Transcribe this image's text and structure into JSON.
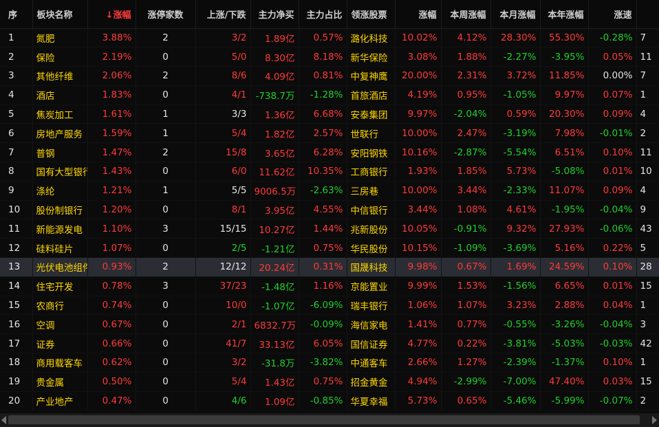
{
  "headers": {
    "seq": "序",
    "name": "板块名称",
    "sort_arrow": "↓",
    "change": "涨幅",
    "limit_up": "涨停家数",
    "updown": "上涨/下跌",
    "net_inflow": "主力净买",
    "ratio": "主力占比",
    "leader": "领涨股票",
    "leader_change": "涨幅",
    "week": "本周涨幅",
    "month": "本月涨幅",
    "year": "本年涨幅",
    "speed": "涨速",
    "extra": ""
  },
  "colors": {
    "up": "#ff3a3a",
    "down": "#1fd12b",
    "name": "#ffd700",
    "selected_row": "#2a2d33"
  },
  "selected_index": 13,
  "rows": [
    {
      "seq": "1",
      "name": "氮肥",
      "change": "3.88%",
      "limit": "2",
      "ud": "3/2",
      "net": "1.89亿",
      "ratio": "0.57%",
      "stock": "潞化科技",
      "schg": "10.02%",
      "week": "4.12%",
      "month": "28.30%",
      "year": "55.30%",
      "speed": "-0.28%",
      "extra": "7"
    },
    {
      "seq": "2",
      "name": "保险",
      "change": "2.19%",
      "limit": "0",
      "ud": "5/0",
      "net": "8.30亿",
      "ratio": "8.18%",
      "stock": "新华保险",
      "schg": "3.08%",
      "week": "1.88%",
      "month": "-2.27%",
      "year": "-3.95%",
      "speed": "0.05%",
      "extra": "11"
    },
    {
      "seq": "3",
      "name": "其他纤维",
      "change": "2.06%",
      "limit": "2",
      "ud": "8/6",
      "net": "4.09亿",
      "ratio": "0.81%",
      "stock": "中复神鹰",
      "schg": "20.00%",
      "week": "2.31%",
      "month": "3.72%",
      "year": "11.85%",
      "speed": "0.00%",
      "extra": "7"
    },
    {
      "seq": "4",
      "name": "酒店",
      "change": "1.83%",
      "limit": "0",
      "ud": "4/1",
      "net": "-738.7万",
      "ratio": "-1.28%",
      "stock": "首旅酒店",
      "schg": "4.19%",
      "week": "0.95%",
      "month": "-1.05%",
      "year": "9.97%",
      "speed": "0.07%",
      "extra": "1"
    },
    {
      "seq": "5",
      "name": "焦炭加工",
      "change": "1.61%",
      "limit": "1",
      "ud": "3/3",
      "net": "1.36亿",
      "ratio": "6.68%",
      "stock": "安泰集团",
      "schg": "9.97%",
      "week": "-2.04%",
      "month": "0.59%",
      "year": "20.30%",
      "speed": "0.09%",
      "extra": "4"
    },
    {
      "seq": "6",
      "name": "房地产服务",
      "change": "1.59%",
      "limit": "1",
      "ud": "5/4",
      "net": "1.82亿",
      "ratio": "2.57%",
      "stock": "世联行",
      "schg": "10.00%",
      "week": "2.47%",
      "month": "-3.19%",
      "year": "7.98%",
      "speed": "-0.01%",
      "extra": "2"
    },
    {
      "seq": "7",
      "name": "普钢",
      "change": "1.47%",
      "limit": "2",
      "ud": "15/8",
      "net": "3.65亿",
      "ratio": "6.28%",
      "stock": "安阳钢铁",
      "schg": "10.16%",
      "week": "-2.87%",
      "month": "-5.54%",
      "year": "6.51%",
      "speed": "0.10%",
      "extra": "11"
    },
    {
      "seq": "8",
      "name": "国有大型银行",
      "change": "1.43%",
      "limit": "0",
      "ud": "6/0",
      "net": "11.62亿",
      "ratio": "10.35%",
      "stock": "工商银行",
      "schg": "1.93%",
      "week": "1.85%",
      "month": "5.73%",
      "year": "-5.08%",
      "speed": "0.01%",
      "extra": "10"
    },
    {
      "seq": "9",
      "name": "涤纶",
      "change": "1.21%",
      "limit": "1",
      "ud": "5/5",
      "net": "9006.5万",
      "ratio": "-2.63%",
      "stock": "三房巷",
      "schg": "10.00%",
      "week": "3.44%",
      "month": "-2.33%",
      "year": "11.07%",
      "speed": "0.09%",
      "extra": "4"
    },
    {
      "seq": "10",
      "name": "股份制银行",
      "change": "1.20%",
      "limit": "0",
      "ud": "8/1",
      "net": "3.95亿",
      "ratio": "4.55%",
      "stock": "中信银行",
      "schg": "3.44%",
      "week": "1.08%",
      "month": "4.61%",
      "year": "-1.95%",
      "speed": "-0.04%",
      "extra": "9"
    },
    {
      "seq": "11",
      "name": "新能源发电",
      "change": "1.10%",
      "limit": "3",
      "ud": "15/15",
      "net": "10.27亿",
      "ratio": "1.44%",
      "stock": "兆新股份",
      "schg": "10.05%",
      "week": "-0.91%",
      "month": "9.32%",
      "year": "27.93%",
      "speed": "-0.06%",
      "extra": "43"
    },
    {
      "seq": "12",
      "name": "硅料硅片",
      "change": "1.07%",
      "limit": "0",
      "ud": "2/5",
      "net": "-1.21亿",
      "ratio": "0.75%",
      "stock": "华民股份",
      "schg": "10.15%",
      "week": "-1.09%",
      "month": "-3.69%",
      "year": "5.16%",
      "speed": "0.22%",
      "extra": "5"
    },
    {
      "seq": "13",
      "name": "光伏电池组件",
      "change": "0.93%",
      "limit": "2",
      "ud": "12/12",
      "net": "20.24亿",
      "ratio": "0.31%",
      "stock": "国晟科技",
      "schg": "9.98%",
      "week": "0.67%",
      "month": "1.69%",
      "year": "24.59%",
      "speed": "0.10%",
      "extra": "28"
    },
    {
      "seq": "14",
      "name": "住宅开发",
      "change": "0.78%",
      "limit": "3",
      "ud": "37/23",
      "net": "-1.48亿",
      "ratio": "1.16%",
      "stock": "京能置业",
      "schg": "9.99%",
      "week": "1.53%",
      "month": "-1.56%",
      "year": "6.65%",
      "speed": "0.01%",
      "extra": "15"
    },
    {
      "seq": "15",
      "name": "农商行",
      "change": "0.74%",
      "limit": "0",
      "ud": "10/0",
      "net": "-1.07亿",
      "ratio": "-6.09%",
      "stock": "瑞丰银行",
      "schg": "1.06%",
      "week": "1.07%",
      "month": "3.23%",
      "year": "2.88%",
      "speed": "0.04%",
      "extra": "1"
    },
    {
      "seq": "16",
      "name": "空调",
      "change": "0.67%",
      "limit": "0",
      "ud": "2/1",
      "net": "6832.7万",
      "ratio": "-0.09%",
      "stock": "海信家电",
      "schg": "1.41%",
      "week": "0.77%",
      "month": "-0.55%",
      "year": "-3.26%",
      "speed": "-0.04%",
      "extra": "3"
    },
    {
      "seq": "17",
      "name": "证券",
      "change": "0.66%",
      "limit": "0",
      "ud": "41/7",
      "net": "33.13亿",
      "ratio": "6.05%",
      "stock": "国信证券",
      "schg": "4.77%",
      "week": "0.22%",
      "month": "-3.81%",
      "year": "-5.03%",
      "speed": "-0.03%",
      "extra": "42"
    },
    {
      "seq": "18",
      "name": "商用载客车",
      "change": "0.62%",
      "limit": "0",
      "ud": "3/2",
      "net": "-31.8万",
      "ratio": "-3.82%",
      "stock": "中通客车",
      "schg": "2.66%",
      "week": "1.27%",
      "month": "-2.39%",
      "year": "-1.37%",
      "speed": "0.10%",
      "extra": "1"
    },
    {
      "seq": "19",
      "name": "贵金属",
      "change": "0.50%",
      "limit": "0",
      "ud": "5/4",
      "net": "1.43亿",
      "ratio": "0.75%",
      "stock": "招金黄金",
      "schg": "4.94%",
      "week": "-2.99%",
      "month": "-7.00%",
      "year": "47.40%",
      "speed": "0.03%",
      "extra": "15"
    },
    {
      "seq": "20",
      "name": "产业地产",
      "change": "0.47%",
      "limit": "0",
      "ud": "4/6",
      "net": "1.09亿",
      "ratio": "-0.85%",
      "stock": "华夏幸福",
      "schg": "5.73%",
      "week": "0.65%",
      "month": "-5.46%",
      "year": "-5.99%",
      "speed": "-0.07%",
      "extra": "2"
    }
  ]
}
